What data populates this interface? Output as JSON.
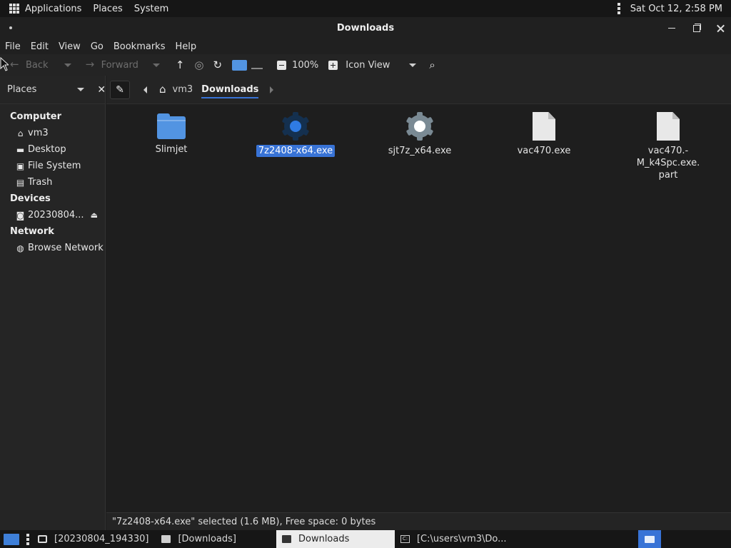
{
  "topbar": {
    "menus": [
      "Applications",
      "Places",
      "System"
    ],
    "clock": "Sat Oct 12,  2:58 PM"
  },
  "window": {
    "title": "Downloads"
  },
  "menubar": [
    "File",
    "Edit",
    "View",
    "Go",
    "Bookmarks",
    "Help"
  ],
  "toolbar": {
    "back_label": "Back",
    "forward_label": "Forward",
    "zoom": "100%",
    "view_mode": "Icon View"
  },
  "sidebar": {
    "header": "Places",
    "sections": {
      "computer": "Computer",
      "devices": "Devices",
      "network": "Network"
    },
    "computer_items": [
      "vm3",
      "Desktop",
      "File System",
      "Trash"
    ],
    "device_items": [
      "20230804..."
    ],
    "network_items": [
      "Browse Network"
    ]
  },
  "pathbar": {
    "crumbs": [
      "vm3",
      "Downloads"
    ]
  },
  "files": [
    {
      "name": "Slimjet",
      "type": "folder",
      "selected": false
    },
    {
      "name": "7z2408-x64.exe",
      "type": "exe",
      "selected": true
    },
    {
      "name": "sjt7z_x64.exe",
      "type": "exe",
      "selected": false
    },
    {
      "name": "vac470.exe",
      "type": "document",
      "selected": false
    },
    {
      "name": "vac470.-M_k4Spc.exe.\npart",
      "type": "document",
      "selected": false
    }
  ],
  "status": "\"7z2408-x64.exe\" selected (1.6 MB), Free space: 0 bytes",
  "taskbar": {
    "tasks": [
      "[20230804_194330]",
      "[Downloads]",
      "Downloads",
      "[C:\\users\\vm3\\Do..."
    ]
  },
  "colors": {
    "accent": "#3873d6",
    "folder": "#5294e2",
    "background": "#1e1e1e"
  }
}
